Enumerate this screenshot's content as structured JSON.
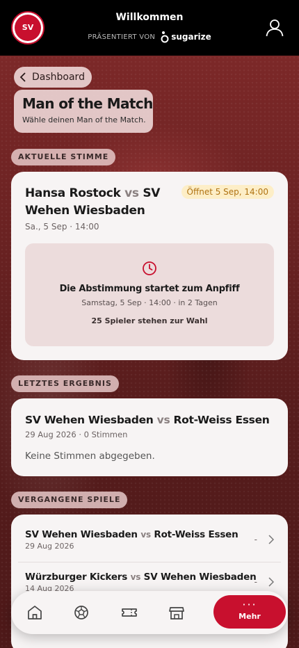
{
  "header": {
    "title": "Willkommen",
    "presented_by": "PRÄSENTIERT VON",
    "sponsor": "sugarize",
    "logo_text": "SV"
  },
  "nav": {
    "back_label": "Dashboard"
  },
  "hero": {
    "title": "Man of the Match",
    "subtitle": "Wähle deinen Man of the Match."
  },
  "current_vote": {
    "section_label": "AKTUELLE STIMME",
    "home_line1": "Hansa Rostock",
    "vs": "vs",
    "away_part1": "SV",
    "away_line2": "Wehen Wiesbaden",
    "meta": "Sa., 5 Sep · 14:00",
    "badge": "Öffnet 5 Sep, 14:00",
    "box_title": "Die Abstimmung startet zum Anpfiff",
    "box_sub": "Samstag, 5 Sep · 14:00 · in 2 Tagen",
    "box_players": "25 Spieler stehen zur Wahl"
  },
  "last_result": {
    "section_label": "LETZTES ERGEBNIS",
    "home": "SV Wehen Wiesbaden",
    "vs": "vs",
    "away": "Rot-Weiss Essen",
    "meta": "29 Aug 2026 · 0 Stimmen",
    "empty": "Keine Stimmen abgegeben."
  },
  "past_matches": {
    "section_label": "VERGANGENE SPIELE",
    "items": [
      {
        "home": "SV Wehen Wiesbaden",
        "vs": "vs",
        "away": "Rot-Weiss Essen",
        "date": "29 Aug 2026",
        "score": "-"
      },
      {
        "home": "Würzburger Kickers",
        "vs": "vs",
        "away": "SV Wehen Wiesbaden",
        "date": "14 Aug 2026",
        "score": "-"
      }
    ]
  },
  "tabbar": {
    "items": [
      {
        "icon": "home-icon"
      },
      {
        "icon": "football-icon"
      },
      {
        "icon": "ticket-icon"
      },
      {
        "icon": "shop-icon"
      }
    ],
    "more_dots": "···",
    "more_label": "Mehr"
  },
  "colors": {
    "brand": "#c8102e",
    "badge_bg": "#fdeec7",
    "badge_text": "#b07312"
  }
}
